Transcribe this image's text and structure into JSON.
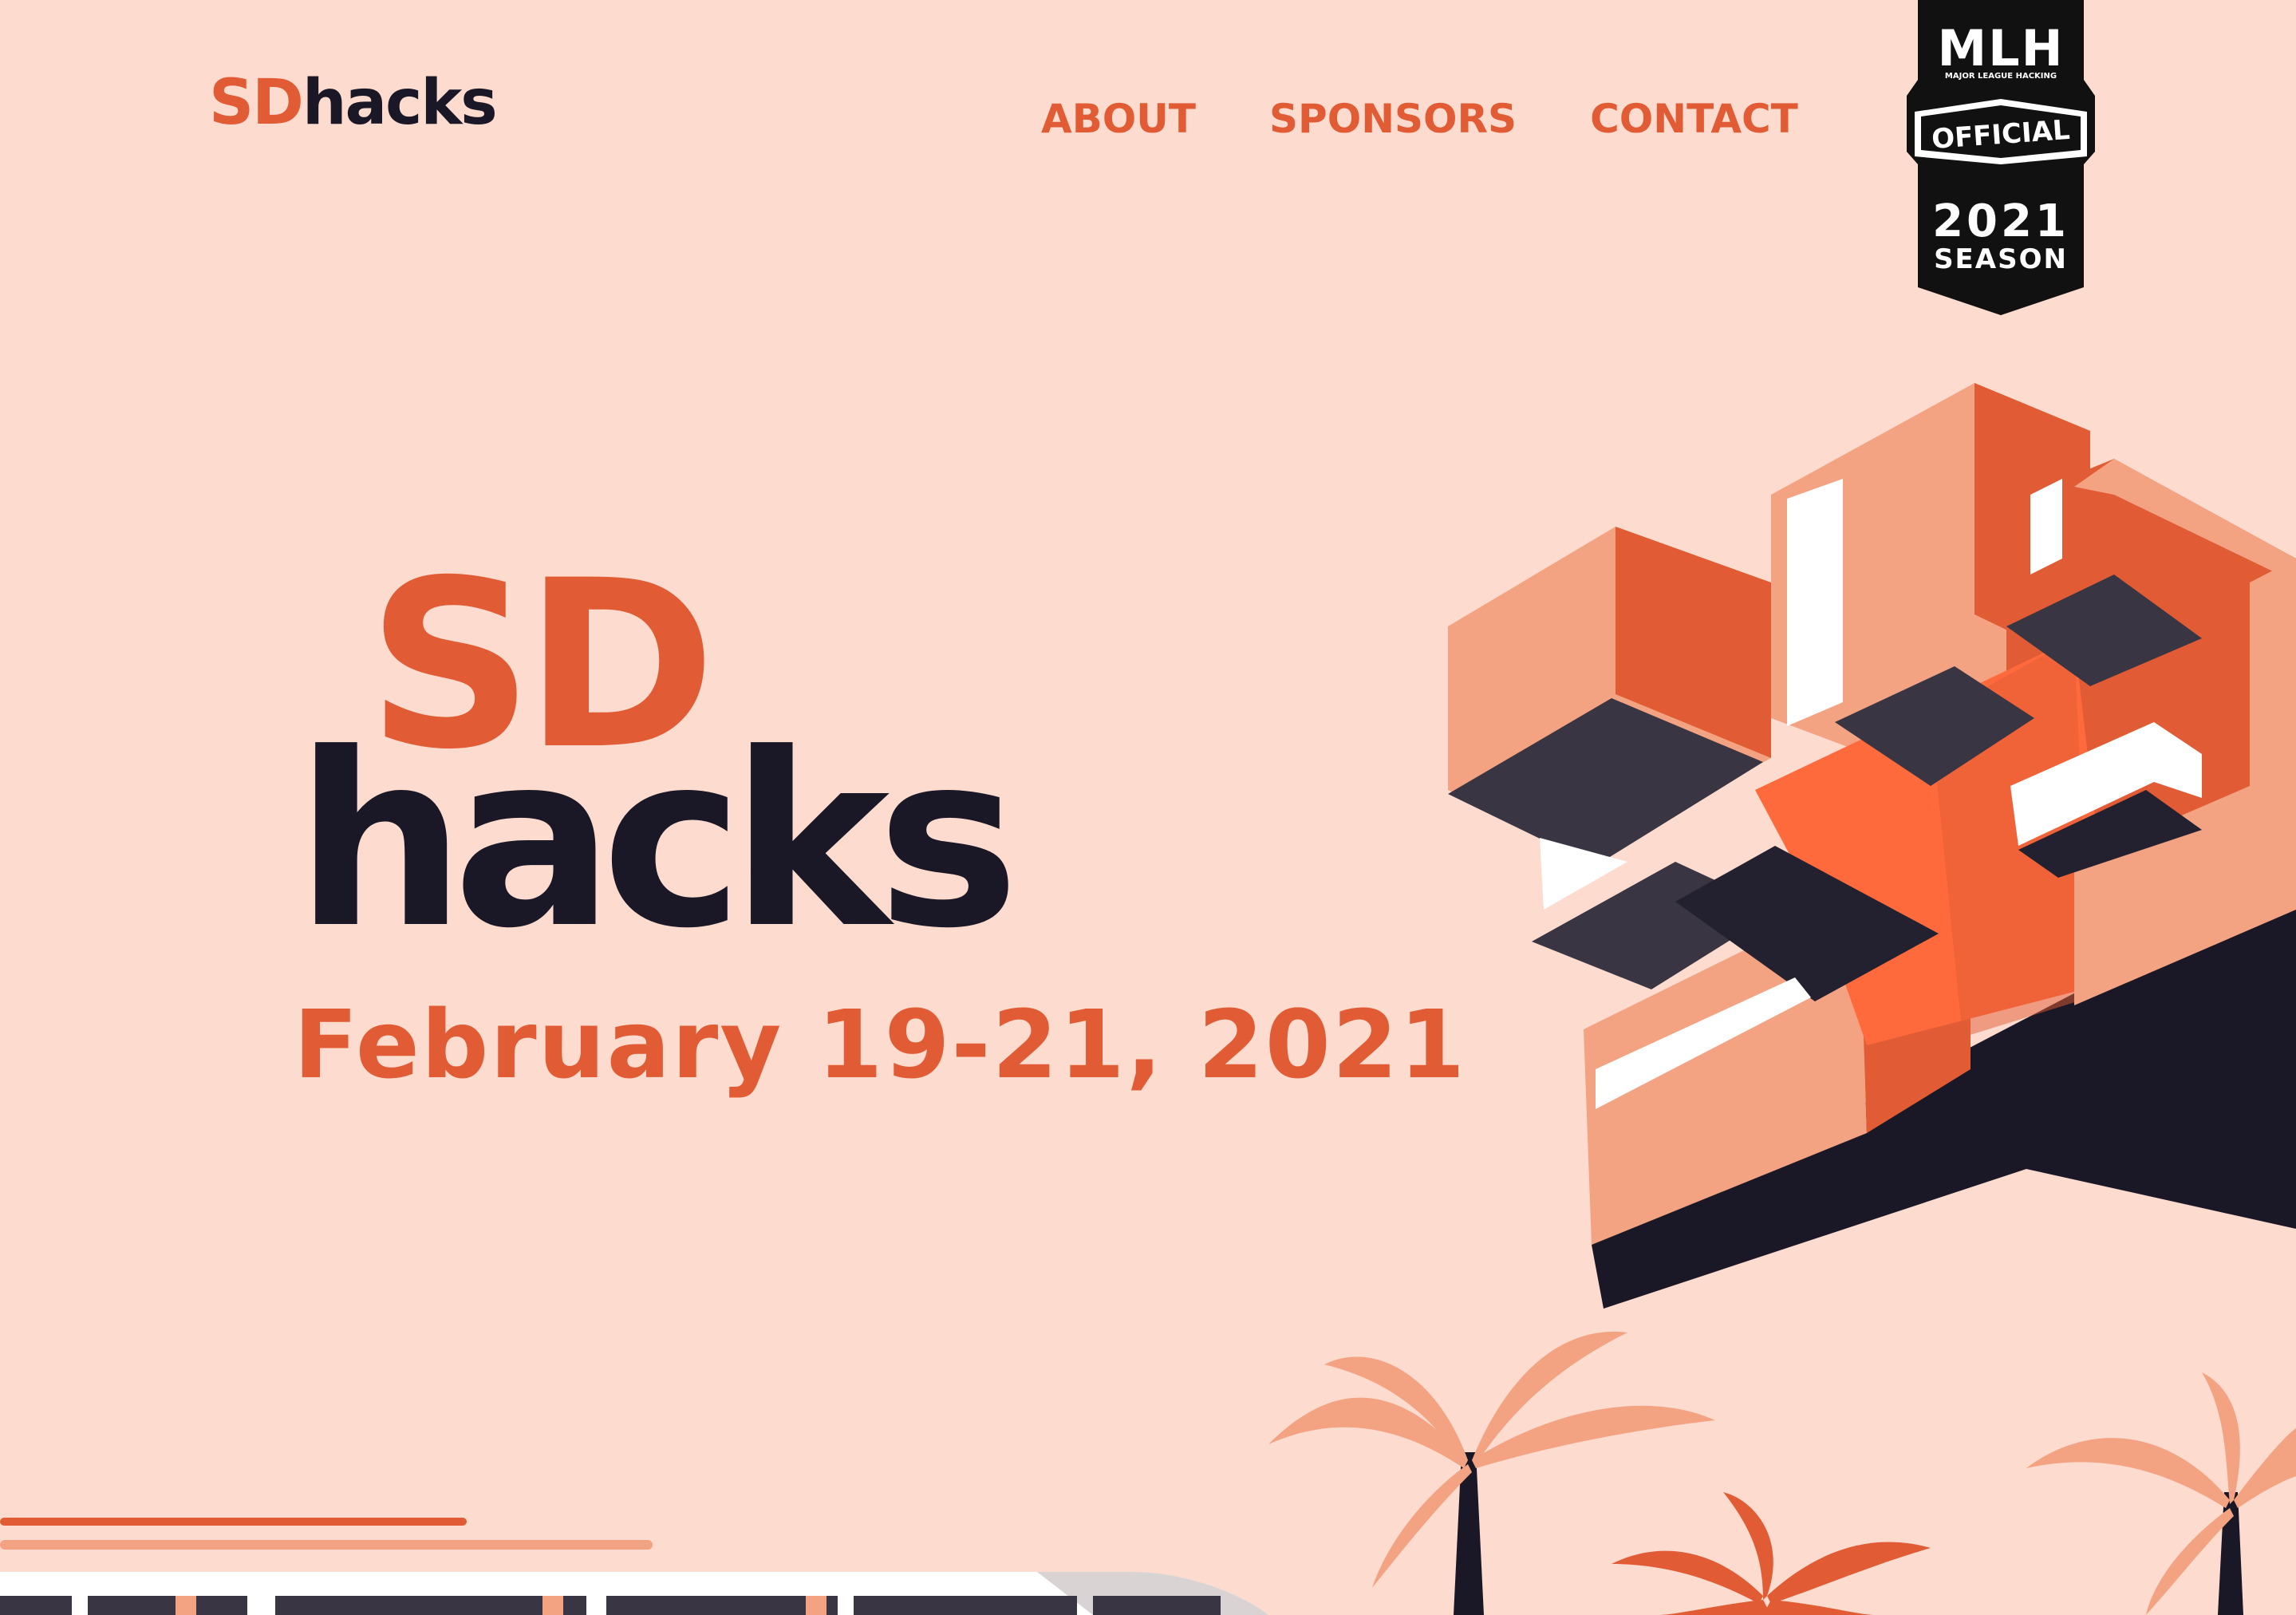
{
  "header": {
    "logo": {
      "sd": "SD",
      "hacks": "hacks"
    },
    "nav": [
      {
        "label": "ABOUT"
      },
      {
        "label": "SPONSORS"
      },
      {
        "label": "CONTACT"
      }
    ]
  },
  "mlh_badge": {
    "brand": "MLH",
    "tagline": "MAJOR LEAGUE HACKING",
    "official": "OFFICIAL",
    "year": "2021",
    "season": "SEASON"
  },
  "hero": {
    "title_sd": "SD",
    "title_hacks": "hacks",
    "date": "February 19-21, 2021"
  },
  "colors": {
    "background": "#fddbcf",
    "accent": "#e15c34",
    "dark": "#1a1826",
    "light_orange": "#f4a382",
    "bright_orange": "#ff6a3d"
  }
}
